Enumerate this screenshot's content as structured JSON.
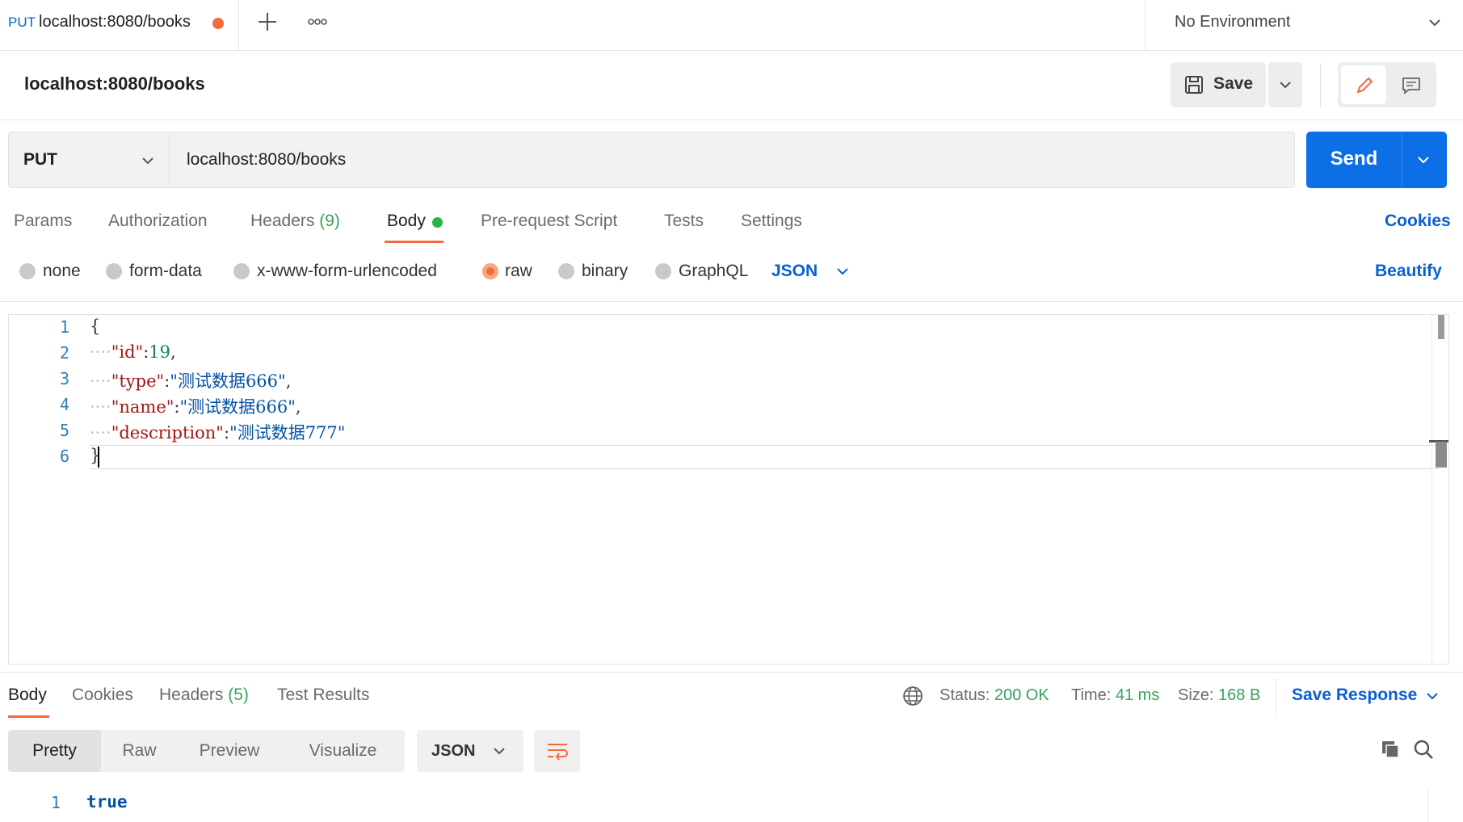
{
  "tab": {
    "method": "PUT",
    "title": "localhost:8080/books"
  },
  "environment": {
    "selected": "No Environment"
  },
  "request": {
    "title": "localhost:8080/books",
    "save_label": "Save",
    "method": "PUT",
    "url": "localhost:8080/books",
    "send_label": "Send"
  },
  "request_tabs": {
    "params": "Params",
    "authorization": "Authorization",
    "headers": "Headers",
    "headers_count": "(9)",
    "body": "Body",
    "pre_request": "Pre-request Script",
    "tests": "Tests",
    "settings": "Settings",
    "cookies": "Cookies"
  },
  "body_options": {
    "none": "none",
    "form_data": "form-data",
    "urlencoded": "x-www-form-urlencoded",
    "raw": "raw",
    "binary": "binary",
    "graphql": "GraphQL",
    "format": "JSON",
    "beautify": "Beautify",
    "selected": "raw"
  },
  "editor": {
    "line_numbers": [
      "1",
      "2",
      "3",
      "4",
      "5",
      "6"
    ],
    "open_brace": "{",
    "close_brace": "}",
    "indent": "····",
    "lines": [
      {
        "key": "\"id\"",
        "colon": ":",
        "value": "19",
        "value_type": "number",
        "trail": ","
      },
      {
        "key": "\"type\"",
        "colon": ":",
        "value": "\"测试数据666\"",
        "value_type": "string",
        "trail": ","
      },
      {
        "key": "\"name\"",
        "colon": ":",
        "value": "\"测试数据666\"",
        "value_type": "string",
        "trail": ","
      },
      {
        "key": "\"description\"",
        "colon": ":",
        "value": "\"测试数据777\"",
        "value_type": "string",
        "trail": ""
      }
    ]
  },
  "response": {
    "tabs": {
      "body": "Body",
      "cookies": "Cookies",
      "headers": "Headers",
      "headers_count": "(5)",
      "test_results": "Test Results"
    },
    "status_label": "Status:",
    "status_value": "200 OK",
    "time_label": "Time:",
    "time_value": "41 ms",
    "size_label": "Size:",
    "size_value": "168 B",
    "save_response": "Save Response",
    "views": {
      "pretty": "Pretty",
      "raw": "Raw",
      "preview": "Preview",
      "visualize": "Visualize"
    },
    "format": "JSON",
    "line_number": "1",
    "value": "true"
  },
  "colors": {
    "accent": "#f26b3a",
    "primary": "#0c6fe6",
    "link": "#0b5fd6",
    "success": "#3aa15a"
  },
  "icons": [
    "plus-icon",
    "more-icon",
    "chevron-down-icon",
    "save-icon",
    "edit-icon",
    "comment-icon",
    "globe-icon",
    "wrap-icon",
    "copy-icon",
    "search-icon"
  ]
}
